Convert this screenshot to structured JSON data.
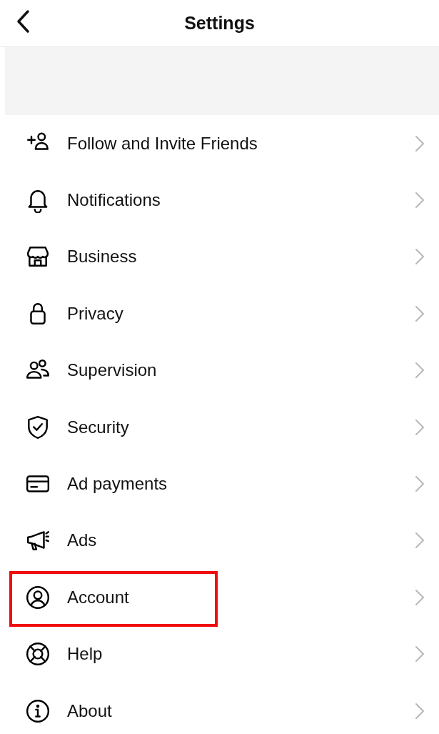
{
  "header": {
    "title": "Settings"
  },
  "items": [
    {
      "label": "Follow and Invite Friends",
      "highlighted": false
    },
    {
      "label": "Notifications",
      "highlighted": false
    },
    {
      "label": "Business",
      "highlighted": false
    },
    {
      "label": "Privacy",
      "highlighted": false
    },
    {
      "label": "Supervision",
      "highlighted": false
    },
    {
      "label": "Security",
      "highlighted": false
    },
    {
      "label": "Ad payments",
      "highlighted": false
    },
    {
      "label": "Ads",
      "highlighted": false
    },
    {
      "label": "Account",
      "highlighted": true
    },
    {
      "label": "Help",
      "highlighted": false
    },
    {
      "label": "About",
      "highlighted": false
    }
  ]
}
